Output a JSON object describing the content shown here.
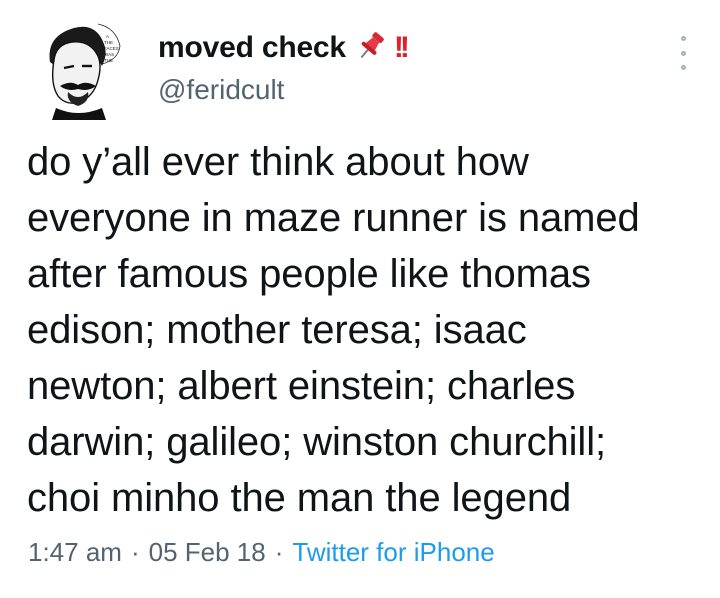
{
  "tweet": {
    "author": {
      "display_name": "moved check",
      "handle": "@feridcult",
      "name_emojis": [
        "pushpin",
        "double-exclamation"
      ]
    },
    "text_lines": [
      "do y’all ever think about how",
      "everyone in maze runner is named",
      "after famous people like thomas",
      "edison; mother teresa; isaac",
      "newton; albert einstein; charles",
      "darwin; galileo; winston churchill;",
      "choi minho the man the legend"
    ],
    "time": "1:47 am",
    "date": "05 Feb 18",
    "separator": "·",
    "source": "Twitter for iPhone"
  },
  "colors": {
    "text": "#0f1419",
    "secondary": "#536471",
    "link": "#1d9bf0",
    "emoji_red": "#e0202c"
  }
}
